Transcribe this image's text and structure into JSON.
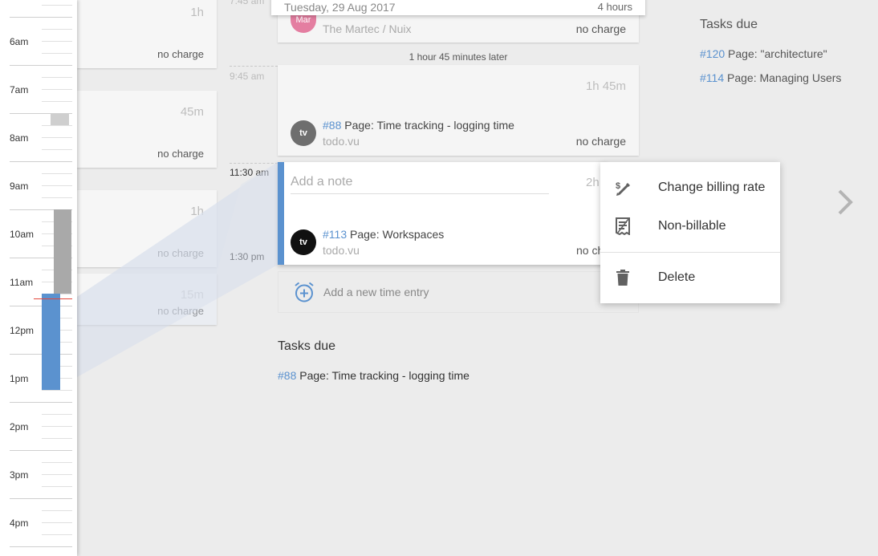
{
  "timeline": {
    "hours": [
      "6am",
      "7am",
      "8am",
      "9am",
      "10am",
      "11am",
      "12pm",
      "1pm",
      "2pm",
      "3pm",
      "4pm"
    ]
  },
  "previous_day": {
    "entries": [
      {
        "duration": "1h",
        "charge": "no charge"
      },
      {
        "duration": "45m",
        "charge": "no charge"
      },
      {
        "duration": "1h",
        "charge": "no charge"
      },
      {
        "duration": "15m",
        "charge": "no charge"
      }
    ]
  },
  "day": {
    "header_date": "Tuesday, 29 Aug 2017",
    "header_total": "4 hours",
    "first_entry": {
      "time": "7:45 am",
      "avatar": "Mar",
      "client": "The Martec / Nuix",
      "charge": "no charge"
    },
    "gap_label": "1 hour 45 minutes later",
    "second_entry": {
      "time": "9:45 am",
      "duration": "1h 45m",
      "avatar": "tv",
      "task_id": "#88",
      "task_title": "Page: Time tracking - logging time",
      "project": "todo.vu",
      "charge": "no charge"
    },
    "active_entry": {
      "start_time": "11:30 am",
      "end_time": "1:30 pm",
      "note_placeholder": "Add a note",
      "duration": "2h",
      "avatar": "tv",
      "task_id": "#113",
      "task_title": "Page: Workspaces",
      "project": "todo.vu",
      "charge": "no ch"
    },
    "add_entry_label": "Add a new time entry",
    "tasks_due_title": "Tasks due",
    "tasks_due": [
      {
        "id": "#88",
        "title": "Page: Time tracking - logging time"
      }
    ]
  },
  "right_panel": {
    "tasks_due_title": "Tasks due",
    "tasks_due": [
      {
        "id": "#120",
        "title": "Page: \"architecture\""
      },
      {
        "id": "#114",
        "title": "Page: Managing Users"
      }
    ]
  },
  "context_menu": {
    "items": [
      {
        "label": "Change billing rate",
        "icon": "change-rate-icon"
      },
      {
        "label": "Non-billable",
        "icon": "receipt-icon"
      },
      {
        "label": "Delete",
        "icon": "trash-icon"
      }
    ]
  },
  "colors": {
    "accent": "#5b92cf",
    "now_line": "#e2483c",
    "avatar_mar": "#e47ea1",
    "avatar_tv_dark": "#111111",
    "avatar_tv_grey": "#6e6e6e"
  },
  "icons": {
    "next": "chevron-right-icon",
    "add_entry": "alarm-add-icon"
  }
}
